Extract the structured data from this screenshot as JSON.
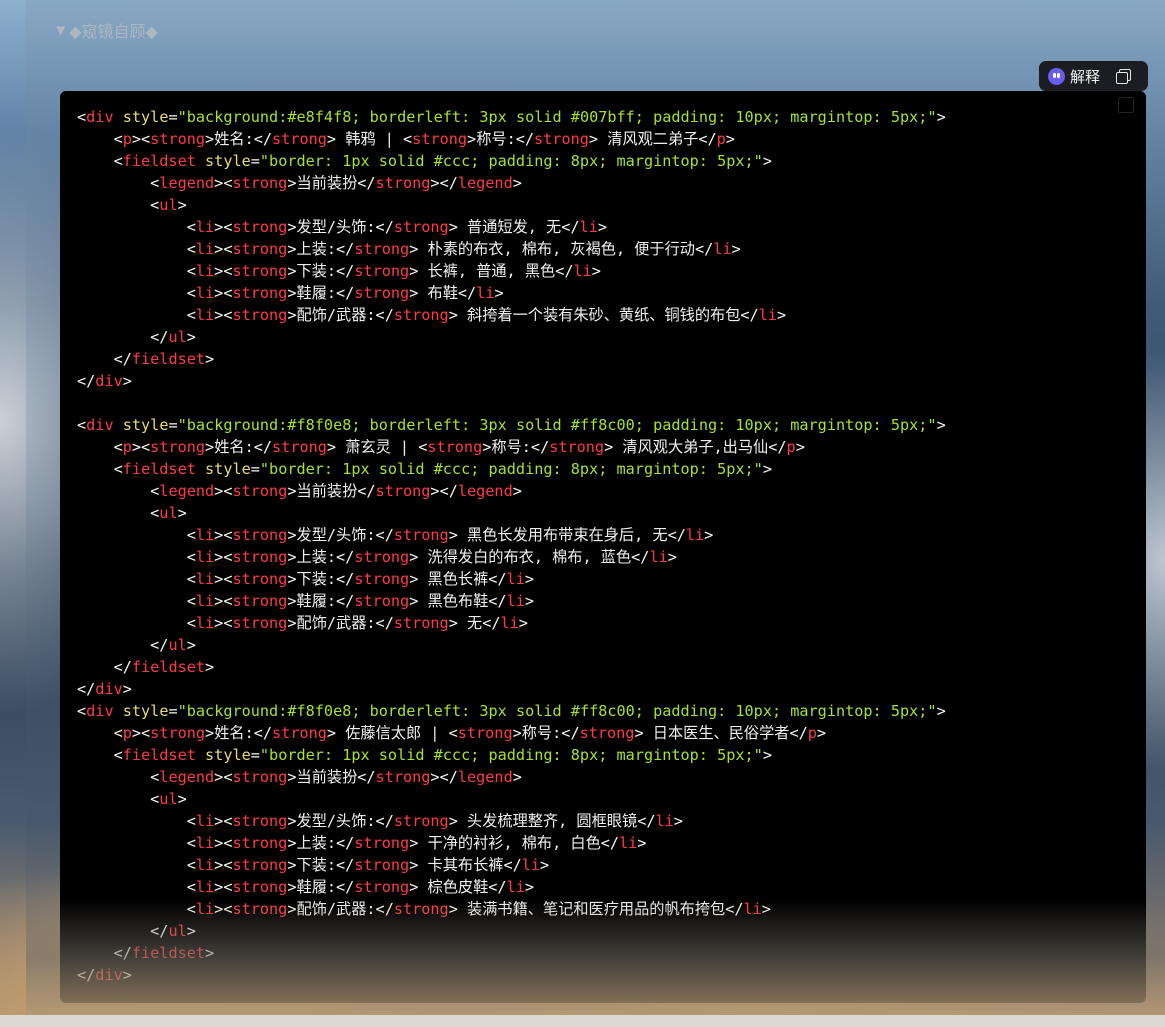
{
  "summary": {
    "label": "◆窥镜自顾◆"
  },
  "toolbar": {
    "explain_label": "解释"
  },
  "code_lines": [
    [
      [
        "punc",
        "<"
      ],
      [
        "tag",
        "div"
      ],
      [
        "punc",
        " "
      ],
      [
        "attr",
        "style"
      ],
      [
        "punc",
        "="
      ],
      [
        "str",
        "\"background:#e8f4f8; borderleft: 3px solid #007bff; padding: 10px; margintop: 5px;\""
      ],
      [
        "punc",
        ">"
      ]
    ],
    [
      [
        "punc",
        "    <"
      ],
      [
        "tag",
        "p"
      ],
      [
        "punc",
        "><"
      ],
      [
        "tag",
        "strong"
      ],
      [
        "punc",
        ">"
      ],
      [
        "txt",
        "姓名:"
      ],
      [
        "punc",
        "</"
      ],
      [
        "tag",
        "strong"
      ],
      [
        "punc",
        "> "
      ],
      [
        "txt",
        "韩鸦 | "
      ],
      [
        "punc",
        "<"
      ],
      [
        "tag",
        "strong"
      ],
      [
        "punc",
        ">"
      ],
      [
        "txt",
        "称号:"
      ],
      [
        "punc",
        "</"
      ],
      [
        "tag",
        "strong"
      ],
      [
        "punc",
        "> "
      ],
      [
        "txt",
        "清风观二弟子"
      ],
      [
        "punc",
        "</"
      ],
      [
        "tag",
        "p"
      ],
      [
        "punc",
        ">"
      ]
    ],
    [
      [
        "punc",
        "    <"
      ],
      [
        "tag",
        "fieldset"
      ],
      [
        "punc",
        " "
      ],
      [
        "attr",
        "style"
      ],
      [
        "punc",
        "="
      ],
      [
        "str",
        "\"border: 1px solid #ccc; padding: 8px; margintop: 5px;\""
      ],
      [
        "punc",
        ">"
      ]
    ],
    [
      [
        "punc",
        "        <"
      ],
      [
        "tag",
        "legend"
      ],
      [
        "punc",
        "><"
      ],
      [
        "tag",
        "strong"
      ],
      [
        "punc",
        ">"
      ],
      [
        "txt",
        "当前装扮"
      ],
      [
        "punc",
        "</"
      ],
      [
        "tag",
        "strong"
      ],
      [
        "punc",
        "></"
      ],
      [
        "tag",
        "legend"
      ],
      [
        "punc",
        ">"
      ]
    ],
    [
      [
        "punc",
        "        <"
      ],
      [
        "tag",
        "ul"
      ],
      [
        "punc",
        ">"
      ]
    ],
    [
      [
        "punc",
        "            <"
      ],
      [
        "tag",
        "li"
      ],
      [
        "punc",
        "><"
      ],
      [
        "tag",
        "strong"
      ],
      [
        "punc",
        ">"
      ],
      [
        "txt",
        "发型/头饰:"
      ],
      [
        "punc",
        "</"
      ],
      [
        "tag",
        "strong"
      ],
      [
        "punc",
        "> "
      ],
      [
        "txt",
        "普通短发, 无"
      ],
      [
        "punc",
        "</"
      ],
      [
        "tag",
        "li"
      ],
      [
        "punc",
        ">"
      ]
    ],
    [
      [
        "punc",
        "            <"
      ],
      [
        "tag",
        "li"
      ],
      [
        "punc",
        "><"
      ],
      [
        "tag",
        "strong"
      ],
      [
        "punc",
        ">"
      ],
      [
        "txt",
        "上装:"
      ],
      [
        "punc",
        "</"
      ],
      [
        "tag",
        "strong"
      ],
      [
        "punc",
        "> "
      ],
      [
        "txt",
        "朴素的布衣, 棉布, 灰褐色, 便于行动"
      ],
      [
        "punc",
        "</"
      ],
      [
        "tag",
        "li"
      ],
      [
        "punc",
        ">"
      ]
    ],
    [
      [
        "punc",
        "            <"
      ],
      [
        "tag",
        "li"
      ],
      [
        "punc",
        "><"
      ],
      [
        "tag",
        "strong"
      ],
      [
        "punc",
        ">"
      ],
      [
        "txt",
        "下装:"
      ],
      [
        "punc",
        "</"
      ],
      [
        "tag",
        "strong"
      ],
      [
        "punc",
        "> "
      ],
      [
        "txt",
        "长裤, 普通, 黑色"
      ],
      [
        "punc",
        "</"
      ],
      [
        "tag",
        "li"
      ],
      [
        "punc",
        ">"
      ]
    ],
    [
      [
        "punc",
        "            <"
      ],
      [
        "tag",
        "li"
      ],
      [
        "punc",
        "><"
      ],
      [
        "tag",
        "strong"
      ],
      [
        "punc",
        ">"
      ],
      [
        "txt",
        "鞋履:"
      ],
      [
        "punc",
        "</"
      ],
      [
        "tag",
        "strong"
      ],
      [
        "punc",
        "> "
      ],
      [
        "txt",
        "布鞋"
      ],
      [
        "punc",
        "</"
      ],
      [
        "tag",
        "li"
      ],
      [
        "punc",
        ">"
      ]
    ],
    [
      [
        "punc",
        "            <"
      ],
      [
        "tag",
        "li"
      ],
      [
        "punc",
        "><"
      ],
      [
        "tag",
        "strong"
      ],
      [
        "punc",
        ">"
      ],
      [
        "txt",
        "配饰/武器:"
      ],
      [
        "punc",
        "</"
      ],
      [
        "tag",
        "strong"
      ],
      [
        "punc",
        "> "
      ],
      [
        "txt",
        "斜挎着一个装有朱砂、黄纸、铜钱的布包"
      ],
      [
        "punc",
        "</"
      ],
      [
        "tag",
        "li"
      ],
      [
        "punc",
        ">"
      ]
    ],
    [
      [
        "punc",
        "        </"
      ],
      [
        "tag",
        "ul"
      ],
      [
        "punc",
        ">"
      ]
    ],
    [
      [
        "punc",
        "    </"
      ],
      [
        "tag",
        "fieldset"
      ],
      [
        "punc",
        ">"
      ]
    ],
    [
      [
        "punc",
        "</"
      ],
      [
        "tag",
        "div"
      ],
      [
        "punc",
        ">"
      ]
    ],
    [],
    [
      [
        "punc",
        "<"
      ],
      [
        "tag",
        "div"
      ],
      [
        "punc",
        " "
      ],
      [
        "attr",
        "style"
      ],
      [
        "punc",
        "="
      ],
      [
        "str",
        "\"background:#f8f0e8; borderleft: 3px solid #ff8c00; padding: 10px; margintop: 5px;\""
      ],
      [
        "punc",
        ">"
      ]
    ],
    [
      [
        "punc",
        "    <"
      ],
      [
        "tag",
        "p"
      ],
      [
        "punc",
        "><"
      ],
      [
        "tag",
        "strong"
      ],
      [
        "punc",
        ">"
      ],
      [
        "txt",
        "姓名:"
      ],
      [
        "punc",
        "</"
      ],
      [
        "tag",
        "strong"
      ],
      [
        "punc",
        "> "
      ],
      [
        "txt",
        "萧玄灵 | "
      ],
      [
        "punc",
        "<"
      ],
      [
        "tag",
        "strong"
      ],
      [
        "punc",
        ">"
      ],
      [
        "txt",
        "称号:"
      ],
      [
        "punc",
        "</"
      ],
      [
        "tag",
        "strong"
      ],
      [
        "punc",
        "> "
      ],
      [
        "txt",
        "清风观大弟子,出马仙"
      ],
      [
        "punc",
        "</"
      ],
      [
        "tag",
        "p"
      ],
      [
        "punc",
        ">"
      ]
    ],
    [
      [
        "punc",
        "    <"
      ],
      [
        "tag",
        "fieldset"
      ],
      [
        "punc",
        " "
      ],
      [
        "attr",
        "style"
      ],
      [
        "punc",
        "="
      ],
      [
        "str",
        "\"border: 1px solid #ccc; padding: 8px; margintop: 5px;\""
      ],
      [
        "punc",
        ">"
      ]
    ],
    [
      [
        "punc",
        "        <"
      ],
      [
        "tag",
        "legend"
      ],
      [
        "punc",
        "><"
      ],
      [
        "tag",
        "strong"
      ],
      [
        "punc",
        ">"
      ],
      [
        "txt",
        "当前装扮"
      ],
      [
        "punc",
        "</"
      ],
      [
        "tag",
        "strong"
      ],
      [
        "punc",
        "></"
      ],
      [
        "tag",
        "legend"
      ],
      [
        "punc",
        ">"
      ]
    ],
    [
      [
        "punc",
        "        <"
      ],
      [
        "tag",
        "ul"
      ],
      [
        "punc",
        ">"
      ]
    ],
    [
      [
        "punc",
        "            <"
      ],
      [
        "tag",
        "li"
      ],
      [
        "punc",
        "><"
      ],
      [
        "tag",
        "strong"
      ],
      [
        "punc",
        ">"
      ],
      [
        "txt",
        "发型/头饰:"
      ],
      [
        "punc",
        "</"
      ],
      [
        "tag",
        "strong"
      ],
      [
        "punc",
        "> "
      ],
      [
        "txt",
        "黑色长发用布带束在身后, 无"
      ],
      [
        "punc",
        "</"
      ],
      [
        "tag",
        "li"
      ],
      [
        "punc",
        ">"
      ]
    ],
    [
      [
        "punc",
        "            <"
      ],
      [
        "tag",
        "li"
      ],
      [
        "punc",
        "><"
      ],
      [
        "tag",
        "strong"
      ],
      [
        "punc",
        ">"
      ],
      [
        "txt",
        "上装:"
      ],
      [
        "punc",
        "</"
      ],
      [
        "tag",
        "strong"
      ],
      [
        "punc",
        "> "
      ],
      [
        "txt",
        "洗得发白的布衣, 棉布, 蓝色"
      ],
      [
        "punc",
        "</"
      ],
      [
        "tag",
        "li"
      ],
      [
        "punc",
        ">"
      ]
    ],
    [
      [
        "punc",
        "            <"
      ],
      [
        "tag",
        "li"
      ],
      [
        "punc",
        "><"
      ],
      [
        "tag",
        "strong"
      ],
      [
        "punc",
        ">"
      ],
      [
        "txt",
        "下装:"
      ],
      [
        "punc",
        "</"
      ],
      [
        "tag",
        "strong"
      ],
      [
        "punc",
        "> "
      ],
      [
        "txt",
        "黑色长裤"
      ],
      [
        "punc",
        "</"
      ],
      [
        "tag",
        "li"
      ],
      [
        "punc",
        ">"
      ]
    ],
    [
      [
        "punc",
        "            <"
      ],
      [
        "tag",
        "li"
      ],
      [
        "punc",
        "><"
      ],
      [
        "tag",
        "strong"
      ],
      [
        "punc",
        ">"
      ],
      [
        "txt",
        "鞋履:"
      ],
      [
        "punc",
        "</"
      ],
      [
        "tag",
        "strong"
      ],
      [
        "punc",
        "> "
      ],
      [
        "txt",
        "黑色布鞋"
      ],
      [
        "punc",
        "</"
      ],
      [
        "tag",
        "li"
      ],
      [
        "punc",
        ">"
      ]
    ],
    [
      [
        "punc",
        "            <"
      ],
      [
        "tag",
        "li"
      ],
      [
        "punc",
        "><"
      ],
      [
        "tag",
        "strong"
      ],
      [
        "punc",
        ">"
      ],
      [
        "txt",
        "配饰/武器:"
      ],
      [
        "punc",
        "</"
      ],
      [
        "tag",
        "strong"
      ],
      [
        "punc",
        "> "
      ],
      [
        "txt",
        "无"
      ],
      [
        "punc",
        "</"
      ],
      [
        "tag",
        "li"
      ],
      [
        "punc",
        ">"
      ]
    ],
    [
      [
        "punc",
        "        </"
      ],
      [
        "tag",
        "ul"
      ],
      [
        "punc",
        ">"
      ]
    ],
    [
      [
        "punc",
        "    </"
      ],
      [
        "tag",
        "fieldset"
      ],
      [
        "punc",
        ">"
      ]
    ],
    [
      [
        "punc",
        "</"
      ],
      [
        "tag",
        "div"
      ],
      [
        "punc",
        ">"
      ]
    ],
    [
      [
        "punc",
        "<"
      ],
      [
        "tag",
        "div"
      ],
      [
        "punc",
        " "
      ],
      [
        "attr",
        "style"
      ],
      [
        "punc",
        "="
      ],
      [
        "str",
        "\"background:#f8f0e8; borderleft: 3px solid #ff8c00; padding: 10px; margintop: 5px;\""
      ],
      [
        "punc",
        ">"
      ]
    ],
    [
      [
        "punc",
        "    <"
      ],
      [
        "tag",
        "p"
      ],
      [
        "punc",
        "><"
      ],
      [
        "tag",
        "strong"
      ],
      [
        "punc",
        ">"
      ],
      [
        "txt",
        "姓名:"
      ],
      [
        "punc",
        "</"
      ],
      [
        "tag",
        "strong"
      ],
      [
        "punc",
        "> "
      ],
      [
        "txt",
        "佐藤信太郎 | "
      ],
      [
        "punc",
        "<"
      ],
      [
        "tag",
        "strong"
      ],
      [
        "punc",
        ">"
      ],
      [
        "txt",
        "称号:"
      ],
      [
        "punc",
        "</"
      ],
      [
        "tag",
        "strong"
      ],
      [
        "punc",
        "> "
      ],
      [
        "txt",
        "日本医生、民俗学者"
      ],
      [
        "punc",
        "</"
      ],
      [
        "tag",
        "p"
      ],
      [
        "punc",
        ">"
      ]
    ],
    [
      [
        "punc",
        "    <"
      ],
      [
        "tag",
        "fieldset"
      ],
      [
        "punc",
        " "
      ],
      [
        "attr",
        "style"
      ],
      [
        "punc",
        "="
      ],
      [
        "str",
        "\"border: 1px solid #ccc; padding: 8px; margintop: 5px;\""
      ],
      [
        "punc",
        ">"
      ]
    ],
    [
      [
        "punc",
        "        <"
      ],
      [
        "tag",
        "legend"
      ],
      [
        "punc",
        "><"
      ],
      [
        "tag",
        "strong"
      ],
      [
        "punc",
        ">"
      ],
      [
        "txt",
        "当前装扮"
      ],
      [
        "punc",
        "</"
      ],
      [
        "tag",
        "strong"
      ],
      [
        "punc",
        "></"
      ],
      [
        "tag",
        "legend"
      ],
      [
        "punc",
        ">"
      ]
    ],
    [
      [
        "punc",
        "        <"
      ],
      [
        "tag",
        "ul"
      ],
      [
        "punc",
        ">"
      ]
    ],
    [
      [
        "punc",
        "            <"
      ],
      [
        "tag",
        "li"
      ],
      [
        "punc",
        "><"
      ],
      [
        "tag",
        "strong"
      ],
      [
        "punc",
        ">"
      ],
      [
        "txt",
        "发型/头饰:"
      ],
      [
        "punc",
        "</"
      ],
      [
        "tag",
        "strong"
      ],
      [
        "punc",
        "> "
      ],
      [
        "txt",
        "头发梳理整齐, 圆框眼镜"
      ],
      [
        "punc",
        "</"
      ],
      [
        "tag",
        "li"
      ],
      [
        "punc",
        ">"
      ]
    ],
    [
      [
        "punc",
        "            <"
      ],
      [
        "tag",
        "li"
      ],
      [
        "punc",
        "><"
      ],
      [
        "tag",
        "strong"
      ],
      [
        "punc",
        ">"
      ],
      [
        "txt",
        "上装:"
      ],
      [
        "punc",
        "</"
      ],
      [
        "tag",
        "strong"
      ],
      [
        "punc",
        "> "
      ],
      [
        "txt",
        "干净的衬衫, 棉布, 白色"
      ],
      [
        "punc",
        "</"
      ],
      [
        "tag",
        "li"
      ],
      [
        "punc",
        ">"
      ]
    ],
    [
      [
        "punc",
        "            <"
      ],
      [
        "tag",
        "li"
      ],
      [
        "punc",
        "><"
      ],
      [
        "tag",
        "strong"
      ],
      [
        "punc",
        ">"
      ],
      [
        "txt",
        "下装:"
      ],
      [
        "punc",
        "</"
      ],
      [
        "tag",
        "strong"
      ],
      [
        "punc",
        "> "
      ],
      [
        "txt",
        "卡其布长裤"
      ],
      [
        "punc",
        "</"
      ],
      [
        "tag",
        "li"
      ],
      [
        "punc",
        ">"
      ]
    ],
    [
      [
        "punc",
        "            <"
      ],
      [
        "tag",
        "li"
      ],
      [
        "punc",
        "><"
      ],
      [
        "tag",
        "strong"
      ],
      [
        "punc",
        ">"
      ],
      [
        "txt",
        "鞋履:"
      ],
      [
        "punc",
        "</"
      ],
      [
        "tag",
        "strong"
      ],
      [
        "punc",
        "> "
      ],
      [
        "txt",
        "棕色皮鞋"
      ],
      [
        "punc",
        "</"
      ],
      [
        "tag",
        "li"
      ],
      [
        "punc",
        ">"
      ]
    ],
    [
      [
        "punc",
        "            <"
      ],
      [
        "tag",
        "li"
      ],
      [
        "punc",
        "><"
      ],
      [
        "tag",
        "strong"
      ],
      [
        "punc",
        ">"
      ],
      [
        "txt",
        "配饰/武器:"
      ],
      [
        "punc",
        "</"
      ],
      [
        "tag",
        "strong"
      ],
      [
        "punc",
        "> "
      ],
      [
        "txt",
        "装满书籍、笔记和医疗用品的帆布挎包"
      ],
      [
        "punc",
        "</"
      ],
      [
        "tag",
        "li"
      ],
      [
        "punc",
        ">"
      ]
    ],
    [
      [
        "punc",
        "        </"
      ],
      [
        "tag",
        "ul"
      ],
      [
        "punc",
        ">"
      ]
    ],
    [
      [
        "punc",
        "    </"
      ],
      [
        "tag",
        "fieldset"
      ],
      [
        "punc",
        ">"
      ]
    ],
    [
      [
        "punc",
        "</"
      ],
      [
        "tag",
        "div"
      ],
      [
        "punc",
        ">"
      ]
    ]
  ]
}
